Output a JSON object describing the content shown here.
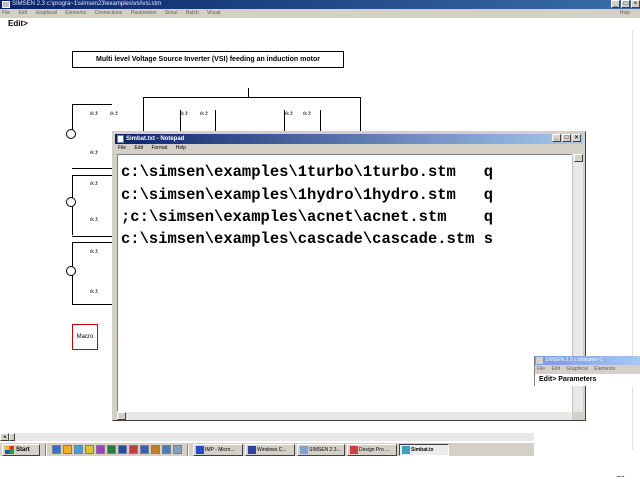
{
  "main_window": {
    "title": "SIMSEN 2.3    c:\\progra~1\\simsen23\\examples\\vsi\\vsi.stm",
    "menu": [
      "File",
      "Edit",
      "Graphical",
      "Elements",
      "Connections",
      "Parameters",
      "Simul",
      "Batch",
      "Visual"
    ],
    "right_menu": "Help",
    "edit_prompt": "Edit>"
  },
  "canvas": {
    "title": "Multi level Voltage Source Inverter (VSI) feeding an induction motor",
    "macro_label": "Macro",
    "switch_label": "ık ž"
  },
  "notepad": {
    "title": "Simbat.txt - Notepad",
    "menu": [
      "File",
      "Edit",
      "Format",
      "Help"
    ],
    "lines": [
      "c:\\simsen\\examples\\1turbo\\1turbo.stm   q",
      "c:\\simsen\\examples\\1hydro\\1hydro.stm   q",
      ";c:\\simsen\\examples\\acnet\\acnet.stm    q",
      "c:\\simsen\\examples\\cascade\\cascade.stm s"
    ]
  },
  "second_window": {
    "title": "SIMSEN 2.3    c:\\docume~1",
    "menu": [
      "File",
      "Edit",
      "Graphical",
      "Elements"
    ],
    "edit_prompt": "Edit> Parameters"
  },
  "taskbar": {
    "start_label": "Start",
    "quick_launch": [
      "ie-icon",
      "outlook-icon",
      "folder-icon",
      "pen-icon",
      "media-icon",
      "calc-icon",
      "chart-icon",
      "app-icon",
      "app-icon",
      "app-icon",
      "app-icon",
      "app-icon"
    ],
    "tasks": [
      {
        "label": "IMP - Micro...",
        "icon": "word-icon",
        "active": false
      },
      {
        "label": "Windows C...",
        "icon": "calendar-icon",
        "active": false
      },
      {
        "label": "SIMSEN 2.3...",
        "icon": "simsen-icon",
        "active": false
      },
      {
        "label": "Design Pro ...",
        "icon": "design-icon",
        "active": false
      },
      {
        "label": "Simbat.tx",
        "icon": "notepad-icon",
        "active": true
      }
    ]
  },
  "colors": {
    "title_active": "#0a246a",
    "title_gradient": "#a6caf0",
    "face": "#d4d0c8",
    "macro_border": "#c00000"
  }
}
